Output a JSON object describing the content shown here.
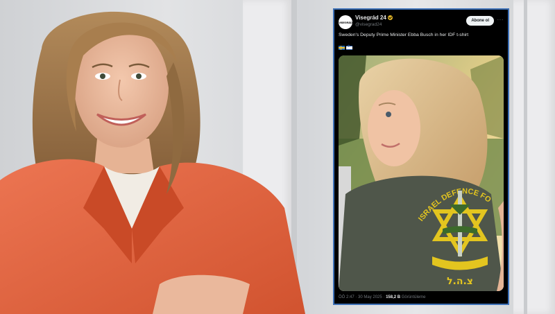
{
  "tweet": {
    "avatar_text": "VISEGRÁD",
    "author_name": "Visegrád 24",
    "author_handle": "@visegrad24",
    "follow_label": "Abone ol",
    "more_label": "···",
    "text": "Sweden's Deputy Prime Minister Ebba Busch in her IDF t-shirt",
    "media_shirt_text": "ISRAEL DEFENCE FO",
    "media_shirt_bottom": "צ.ה.ל",
    "time": "ÖÖ 2:47",
    "date": "30 May 2025",
    "views_count": "158,2 B",
    "views_label": "Görüntüleme"
  },
  "colors": {
    "card_border": "#3b6fb6",
    "follow_bg": "#eff3f4",
    "blazer": "#e1623d",
    "shirt": "#4f564a",
    "emblem": "#e3c51f"
  }
}
